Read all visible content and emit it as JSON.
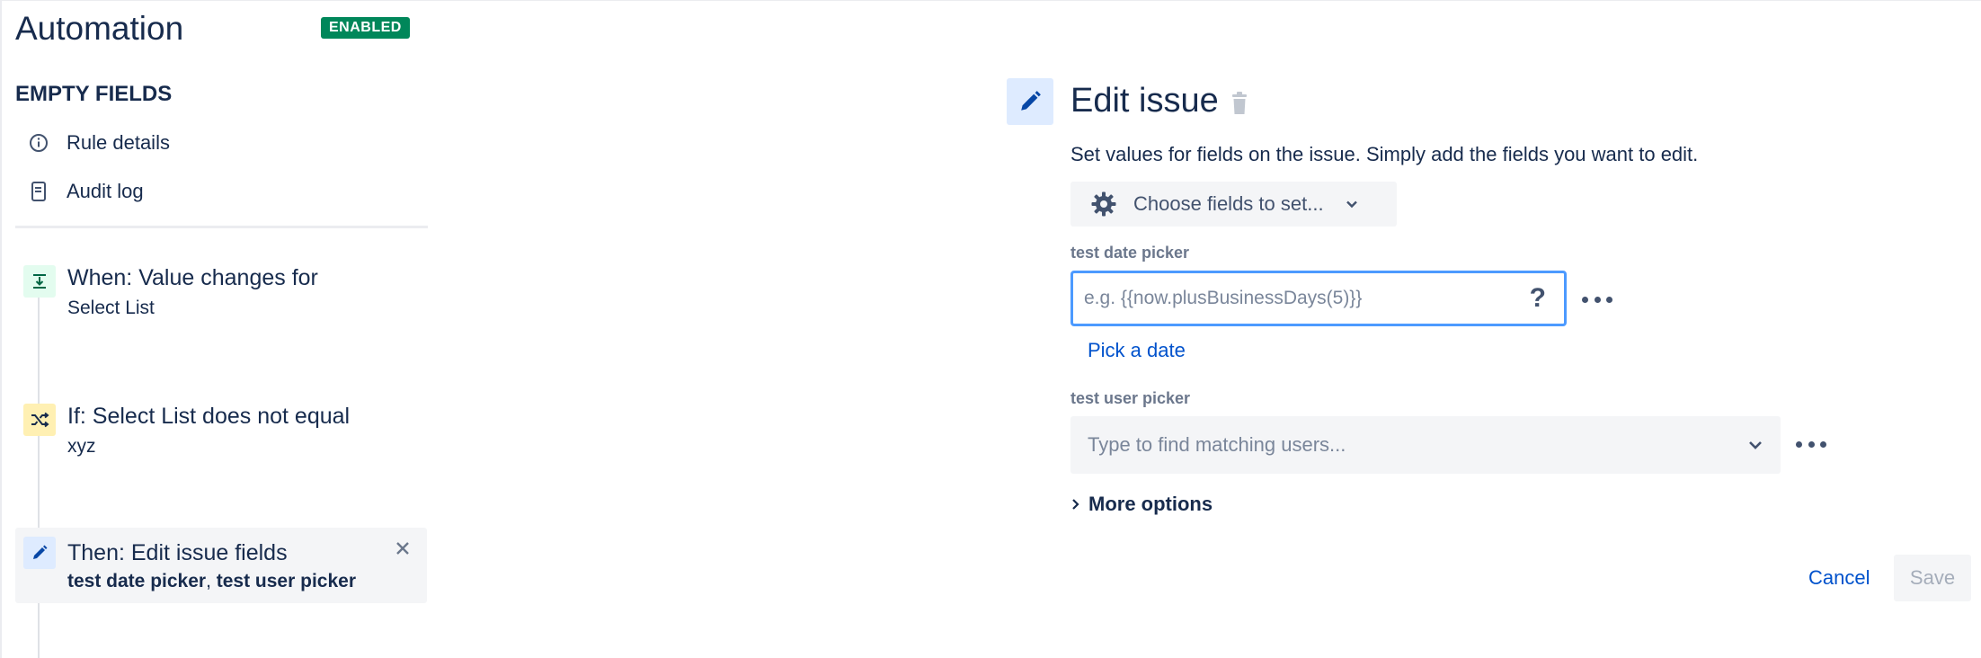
{
  "app": {
    "title": "Automation",
    "status_badge": "ENABLED"
  },
  "rule": {
    "name": "EMPTY FIELDS"
  },
  "nav": [
    {
      "label": "Rule details",
      "icon": "info-icon"
    },
    {
      "label": "Audit log",
      "icon": "document-icon"
    }
  ],
  "steps": {
    "trigger": {
      "title": "When: Value changes for",
      "subtitle": "Select List",
      "icon": "field-change-icon",
      "icon_bg": "#E3FCEF"
    },
    "condition": {
      "title": "If: Select List does not equal",
      "subtitle": "xyz",
      "icon": "shuffle-icon",
      "icon_bg": "#FFF0B3"
    },
    "action": {
      "title": "Then: Edit issue fields",
      "field_1": "test date picker",
      "separator": ", ",
      "field_2": "test user picker",
      "icon": "pencil-icon",
      "icon_bg": "#DEEBFF"
    }
  },
  "editor": {
    "title": "Edit issue",
    "description": "Set values for fields on the issue. Simply add the fields you want to edit.",
    "choose_fields_label": "Choose fields to set...",
    "date_field": {
      "label": "test date picker",
      "placeholder": "e.g. {{now.plusBusinessDays(5)}}",
      "help": "?",
      "pick_link": "Pick a date"
    },
    "user_field": {
      "label": "test user picker",
      "placeholder": "Type to find matching users..."
    },
    "more_options": "More options",
    "cancel_label": "Cancel",
    "save_label": "Save"
  },
  "colors": {
    "accent": "#0052CC",
    "success": "#00875A",
    "text": "#172B4D",
    "focus_border": "#4C9AFF"
  }
}
